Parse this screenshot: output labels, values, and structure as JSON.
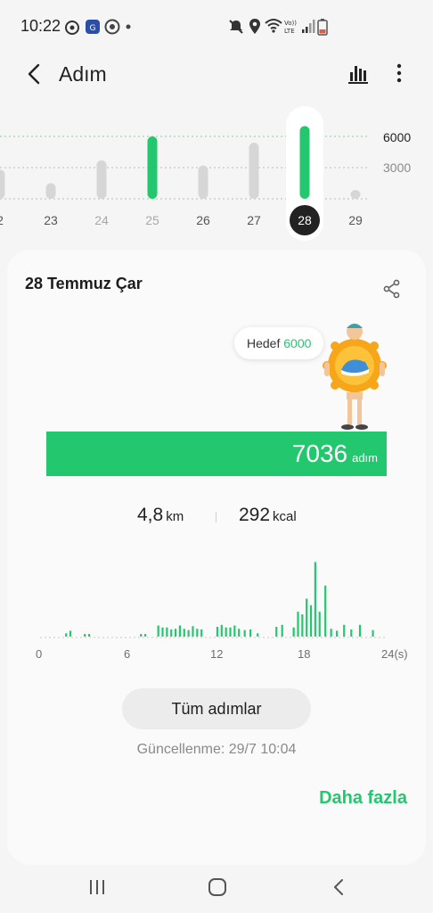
{
  "status_bar": {
    "time": "10:22",
    "icons_left": [
      "alarm-icon",
      "app-icon",
      "chrome-icon",
      "dot-icon"
    ],
    "icons_right": [
      "mute-icon",
      "location-icon",
      "wifi-icon",
      "volte-icon",
      "signal-icon",
      "battery-icon"
    ],
    "volte_text": "Vo))\nLTE"
  },
  "app_bar": {
    "title": "Adım",
    "back_icon": "chevron-left-icon",
    "chart_icon": "bar-chart-icon",
    "menu_icon": "more-vertical-icon"
  },
  "week_chart": {
    "goal_label": "6000",
    "mid_label": "3000",
    "goal_color": "#23c86e",
    "days": [
      {
        "label": "2",
        "steps": 2800,
        "met_goal": false,
        "future": false
      },
      {
        "label": "23",
        "steps": 1500,
        "met_goal": false,
        "future": false
      },
      {
        "label": "24",
        "steps": 3700,
        "met_goal": false,
        "future": true
      },
      {
        "label": "25",
        "steps": 6000,
        "met_goal": true,
        "future": true
      },
      {
        "label": "26",
        "steps": 3200,
        "met_goal": false,
        "future": false
      },
      {
        "label": "27",
        "steps": 5400,
        "met_goal": false,
        "future": false
      },
      {
        "label": "28",
        "steps": 7036,
        "met_goal": true,
        "selected": true
      },
      {
        "label": "29",
        "steps": 200,
        "met_goal": false,
        "future": false
      }
    ]
  },
  "card": {
    "date": "28 Temmuz Çar",
    "share_icon": "share-icon",
    "goal_text": "Hedef",
    "goal_value": "6000",
    "steps_value": "7036",
    "steps_unit": "adım",
    "distance_value": "4,8",
    "distance_unit": "km",
    "calories_value": "292",
    "calories_unit": "kcal",
    "all_steps_button": "Tüm adımlar",
    "updated": "Güncellenme: 29/7 10:04",
    "more": "Daha fazla"
  },
  "chart_data": {
    "type": "bar",
    "x_ticks": [
      "0",
      "6",
      "12",
      "18",
      "24(s)"
    ],
    "x_range": [
      0,
      24
    ],
    "bar_color": "#23c86e",
    "hours": [
      1.8,
      2.1,
      3.1,
      3.4,
      7.0,
      7.3,
      8.2,
      8.5,
      8.8,
      9.1,
      9.4,
      9.7,
      10.0,
      10.3,
      10.6,
      10.9,
      11.2,
      12.3,
      12.6,
      12.9,
      13.2,
      13.5,
      13.8,
      14.2,
      14.6,
      15.1,
      16.4,
      16.8,
      17.6,
      17.9,
      18.2,
      18.5,
      18.8,
      19.1,
      19.4,
      19.8,
      20.2,
      20.6,
      21.1,
      21.6,
      22.2,
      23.1
    ],
    "steps": [
      25,
      45,
      20,
      20,
      20,
      20,
      85,
      70,
      70,
      55,
      60,
      85,
      60,
      50,
      80,
      60,
      55,
      75,
      90,
      70,
      70,
      85,
      60,
      50,
      55,
      25,
      75,
      90,
      70,
      190,
      170,
      290,
      240,
      570,
      190,
      390,
      60,
      45,
      90,
      55,
      90,
      50
    ]
  }
}
